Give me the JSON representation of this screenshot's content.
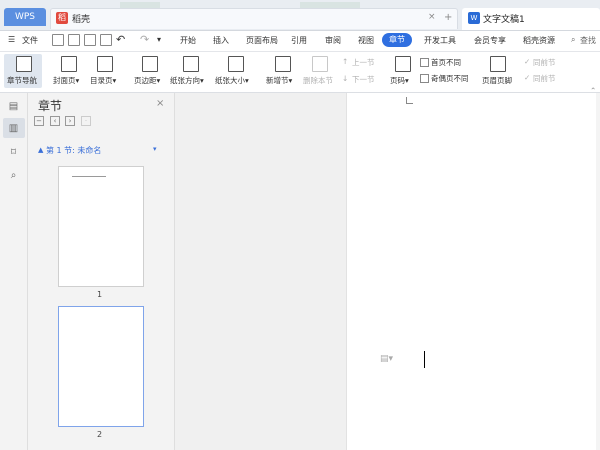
{
  "tabbar": {
    "wps_label": "WPS",
    "daohang_label": "稻壳",
    "daohang_logo": "稻",
    "close_glyph": "×",
    "new_tab_glyph": "+",
    "doc_tab_label": "文字文稿1",
    "doc_logo": "W"
  },
  "menu": {
    "file_label": "文件",
    "undo_glyph": "↶",
    "redo_glyph": "↷",
    "more_glyph": "▾",
    "items": [
      "开始",
      "插入",
      "页面布局",
      "引用",
      "审阅",
      "视图",
      "章节",
      "开发工具",
      "会员专享",
      "稻壳资源"
    ],
    "search_label": "查找"
  },
  "ribbon": {
    "nav_label": "章节导航",
    "cover_label": "封面页▾",
    "toc_label": "目录页▾",
    "margin_label": "页边距▾",
    "orientation_label": "纸张方向▾",
    "size_label": "纸张大小▾",
    "new_section_label": "新增节▾",
    "delete_section_label": "删除本节",
    "prev_section_label": "上一节",
    "next_section_label": "下一节",
    "page_num_label": "页码▾",
    "first_page_diff_label": "首页不同",
    "odd_even_diff_label": "奇偶页不同",
    "header_footer_label": "页眉页脚",
    "same_prev_header_label": "同前节",
    "same_prev_footer_label": "同前节"
  },
  "panel": {
    "title": "章节",
    "close_glyph": "×",
    "section_arrow": "▲",
    "section_label": "第 1 节: 未命名",
    "section_caret": "▾",
    "page1_num": "1",
    "page2_num": "2"
  },
  "icons": {
    "outline": "outline-icon",
    "chapter": "chapter-icon",
    "bookmark": "bookmark-icon",
    "search": "search-icon"
  },
  "colors": {
    "accent": "#2f6fe0",
    "wps_tab": "#5b8fe0",
    "daohang_logo": "#e14a3f"
  }
}
